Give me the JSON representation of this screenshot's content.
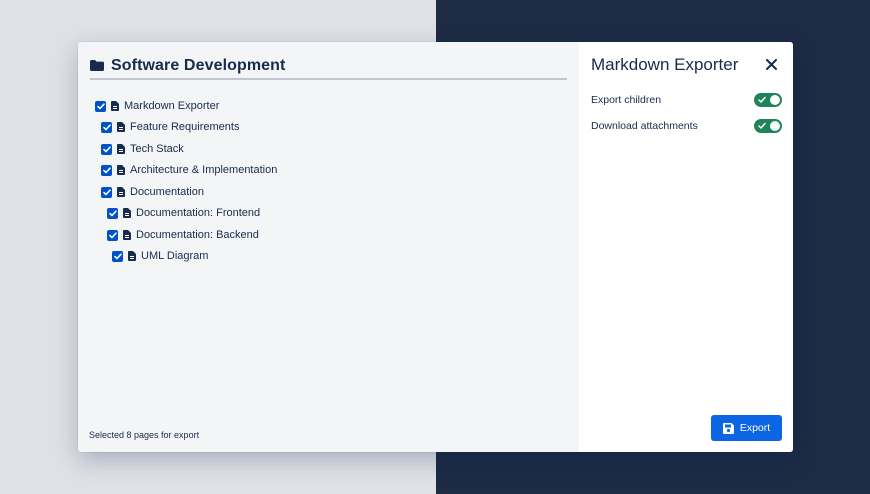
{
  "folder": {
    "title": "Software Development",
    "icon": "folder-icon"
  },
  "tree": [
    {
      "label": "Markdown Exporter",
      "checked": true
    },
    {
      "label": "Feature Requirements",
      "checked": true
    },
    {
      "label": "Tech Stack",
      "checked": true
    },
    {
      "label": "Architecture & Implementation",
      "checked": true
    },
    {
      "label": "Documentation",
      "checked": true
    },
    {
      "label": "Documentation: Frontend",
      "checked": true
    },
    {
      "label": "Documentation: Backend",
      "checked": true
    },
    {
      "label": "UML Diagram",
      "checked": true
    }
  ],
  "status_text": "Selected 8 pages for export",
  "panel": {
    "title": "Markdown Exporter",
    "close_icon": "close-icon",
    "options": [
      {
        "label": "Export children",
        "enabled": true
      },
      {
        "label": "Download attachments",
        "enabled": true
      }
    ],
    "export_label": "Export",
    "export_icon": "save-icon"
  },
  "colors": {
    "primary": "#0C66E4",
    "checkbox": "#0052CC",
    "toggle_on": "#1F845A",
    "text": "#172B4D",
    "backdrop_left": "#DFE1E6",
    "backdrop_right": "#1D2B45"
  }
}
